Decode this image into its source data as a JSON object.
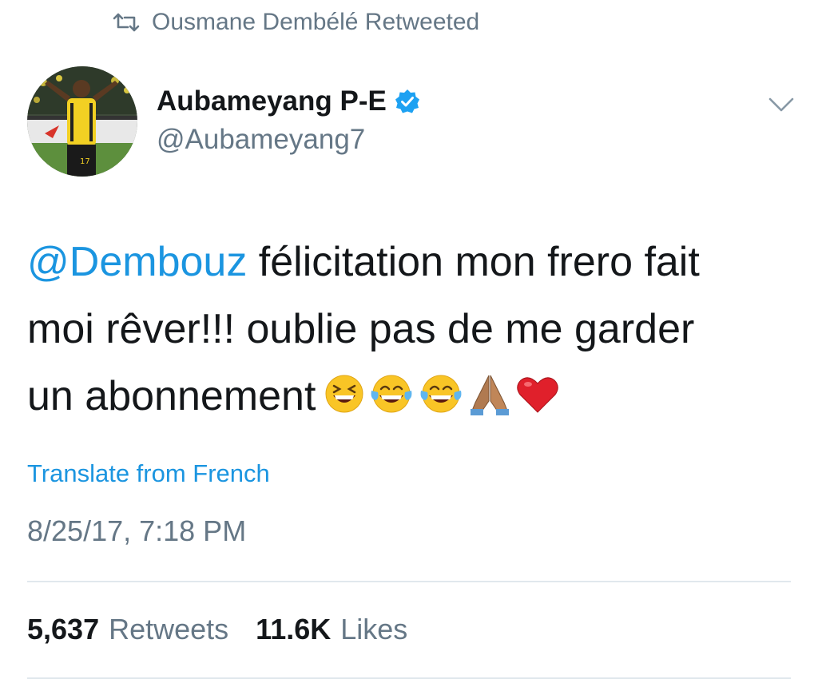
{
  "retweet_context": {
    "text": "Ousmane Dembélé Retweeted",
    "icon": "retweet-icon"
  },
  "author": {
    "name": "Aubameyang P-E",
    "handle": "@Aubameyang7",
    "verified": true,
    "avatar": "avatar-photo"
  },
  "tweet": {
    "mention": "@Dembouz",
    "text_line1": " félicitation mon frero fait",
    "text_line2": "moi rêver!!! oublie pas de me garder",
    "text_line3": "un abonnement",
    "emojis": [
      "laughing-face",
      "tears-of-joy",
      "tears-of-joy",
      "folded-hands",
      "red-heart"
    ]
  },
  "translate": "Translate from French",
  "timestamp": "8/25/17, 7:18 PM",
  "stats": {
    "retweets_count": "5,637",
    "retweets_label": "Retweets",
    "likes_count": "11.6K",
    "likes_label": "Likes"
  },
  "colors": {
    "link": "#1b95e0",
    "secondary_text": "#657786",
    "primary_text": "#14171a",
    "divider": "#e1e8ed",
    "verified": "#1da1f2"
  }
}
